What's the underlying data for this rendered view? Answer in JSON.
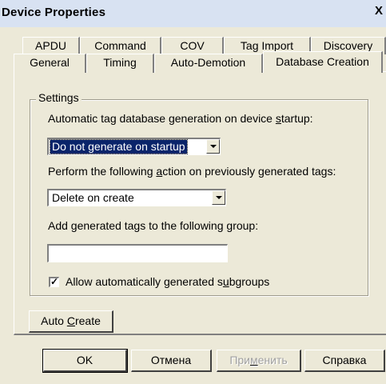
{
  "window": {
    "title": "Device Properties",
    "close_label": "X"
  },
  "tabs_back": [
    "APDU",
    "Command",
    "COV",
    "Tag Import",
    "Discovery"
  ],
  "tabs_front": [
    "General",
    "Timing",
    "Auto-Demotion",
    "Database Creation"
  ],
  "selected_tab": "Database Creation",
  "settings": {
    "group_label": "Settings",
    "startup_label_pre": "Automatic tag database generation on device ",
    "startup_label_acc": "s",
    "startup_label_post": "tartup:",
    "startup_value": "Do not generate on startup",
    "action_label_pre": "Perform the following ",
    "action_label_acc": "a",
    "action_label_post": "ction on previously generated tags:",
    "action_value": "Delete on create",
    "group_field_label_pre": "Add generated tags to the following ",
    "group_field_label_acc": "g",
    "group_field_label_post": "roup:",
    "group_field_value": "",
    "subgroups_pre": "Allow automatically generated s",
    "subgroups_acc": "u",
    "subgroups_post": "bgroups",
    "subgroups_checked": true
  },
  "auto_create": {
    "pre": "Auto ",
    "acc": "C",
    "post": "reate"
  },
  "footer": {
    "ok": "OK",
    "cancel": "Отмена",
    "apply_pre": "При",
    "apply_acc": "м",
    "apply_post": "енить",
    "help": "Справка"
  },
  "colors": {
    "dialog_bg": "#ece9d8",
    "titlebar_bg": "#d8e2f2",
    "selection": "#0a246a"
  }
}
